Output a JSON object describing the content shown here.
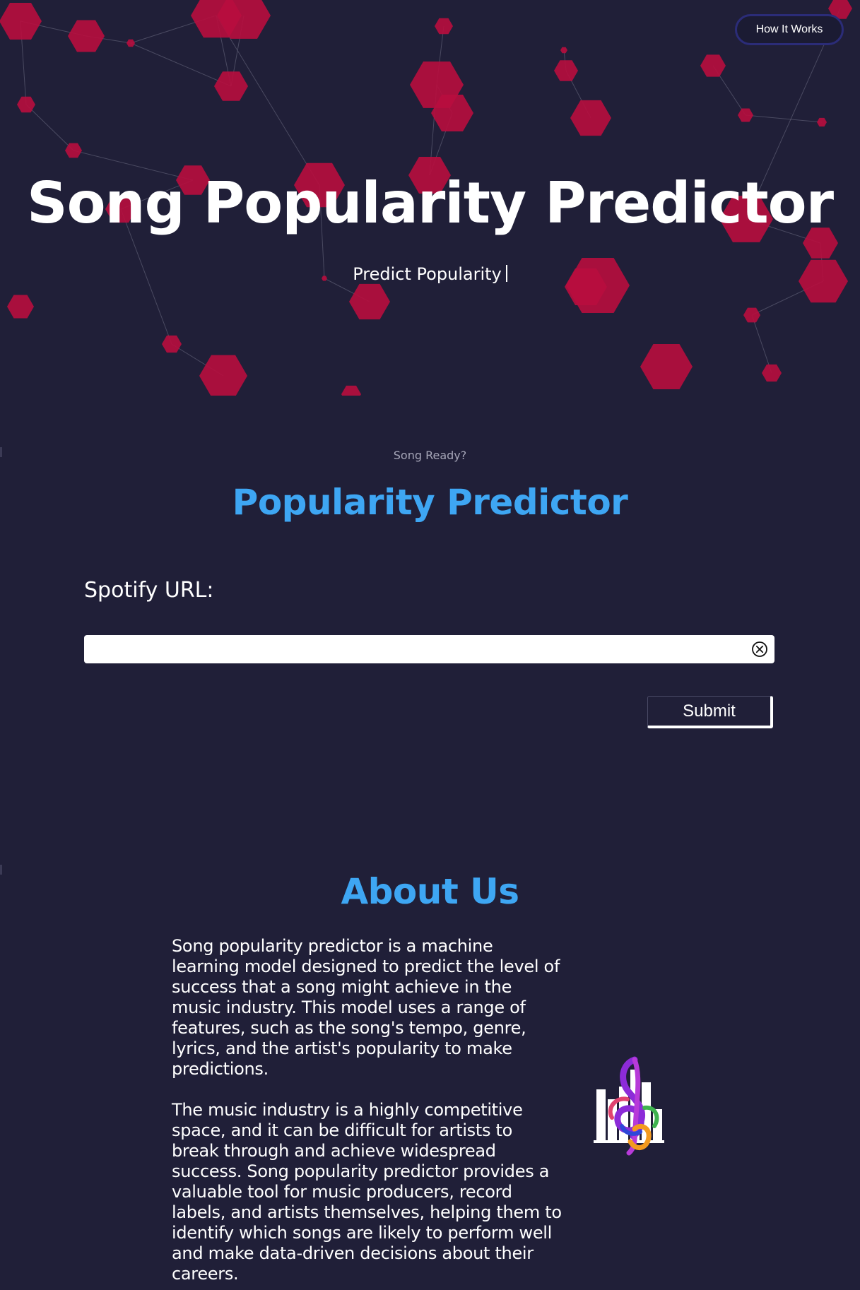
{
  "nav": {
    "how_it_works_label": "How It Works"
  },
  "hero": {
    "title": "Song Popularity Predictor",
    "subtitle": "Predict Popularity"
  },
  "predictor": {
    "eyebrow": "Song Ready?",
    "title": "Popularity Predictor",
    "url_label": "Spotify URL:",
    "url_value": "",
    "url_placeholder": "",
    "submit_label": "Submit"
  },
  "about": {
    "title": "About Us",
    "paragraphs": [
      "Song popularity predictor is a machine learning model designed to predict the level of success that a song might achieve in the music industry. This model uses a range of features, such as the song's tempo, genre, lyrics, and the artist's popularity to make predictions.",
      "The music industry is a highly competitive space, and it can be difficult for artists to break through and achieve widespread success. Song popularity predictor provides a valuable tool for music producers, record labels, and artists themselves, helping them to identify which songs are likely to perform well and make data-driven decisions about their careers."
    ]
  },
  "icons": {
    "clear": "close-circle-icon",
    "logo": "music-chart-logo-icon"
  },
  "colors": {
    "background": "#201f38",
    "accent": "#3ea6f3",
    "hexagon": "#b80d3e",
    "hexagon_link": "#5d5d73",
    "text": "#ffffff",
    "muted_text": "#a6a6b8",
    "nav_border": "#2b2c78"
  }
}
